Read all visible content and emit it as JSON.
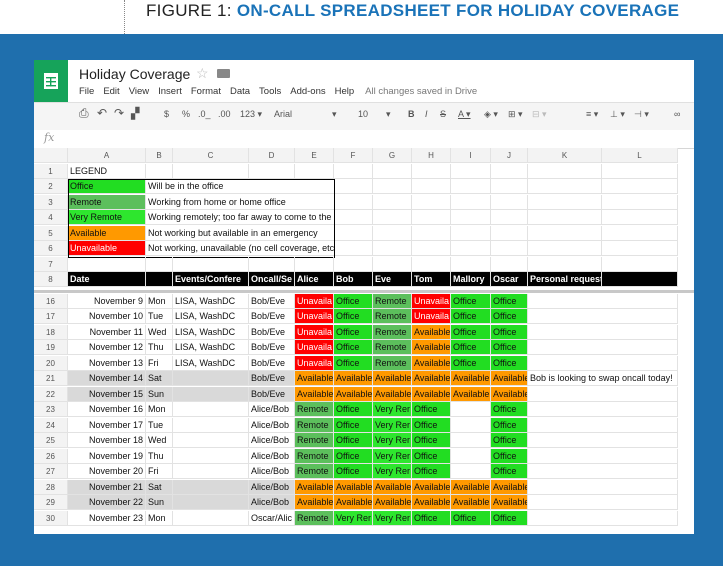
{
  "figure": {
    "title": "FIGURE 1:",
    "subtitle": "ON-CALL SPREADSHEET FOR HOLIDAY COVERAGE"
  },
  "app": {
    "doc_title": "Holiday Coverage",
    "star_icon": "star-icon",
    "folder_icon": "folder-icon"
  },
  "menu": {
    "items": [
      "File",
      "Edit",
      "View",
      "Insert",
      "Format",
      "Data",
      "Tools",
      "Add-ons",
      "Help"
    ],
    "saved": "All changes saved in Drive"
  },
  "toolbar": {
    "currency": "$",
    "percent": "%",
    "dec_less": ".0_",
    "dec_more": ".00",
    "format": "123",
    "font": "Arial",
    "size": "10",
    "bold": "B",
    "italic": "I",
    "strike": "S",
    "textcolor": "A"
  },
  "formula": {
    "label": "fx"
  },
  "columns": [
    "A",
    "B",
    "C",
    "D",
    "E",
    "F",
    "G",
    "H",
    "I",
    "J",
    "K",
    "L"
  ],
  "legend_title": "LEGEND",
  "legend": [
    {
      "row": "2",
      "label": "Office",
      "desc": "Will be in the office",
      "color": "#22dd22"
    },
    {
      "row": "3",
      "label": "Remote",
      "desc": "Working from home or home office",
      "color": "#5cbf5c"
    },
    {
      "row": "4",
      "label": "Very Remote",
      "desc": "Working remotely; too far away to come to the datacenter if needed",
      "color": "#2ee62e"
    },
    {
      "row": "5",
      "label": "Available",
      "desc": "Not working but available in an emergency",
      "color": "#ff9900"
    },
    {
      "row": "6",
      "label": "Unavailable",
      "desc": "Not working, unavailable (no cell coverage, etc.)",
      "color": "#ff0000"
    }
  ],
  "header_row": {
    "num": "8",
    "cells": [
      "Date",
      "",
      "Events/Confere",
      "Oncall/Se",
      "Alice",
      "Bob",
      "Eve",
      "Tom",
      "Mallory",
      "Oscar",
      "Personal requests, notes, etc.",
      ""
    ]
  },
  "rows": [
    {
      "num": "16",
      "date": "November 9",
      "day": "Mon",
      "events": "LISA, WashDC",
      "oncall": "Bob/Eve",
      "s": [
        "Unavaila",
        "Office",
        "Remote",
        "Unavaila",
        "Office",
        "Office"
      ],
      "notes": "",
      "weekend": false
    },
    {
      "num": "17",
      "date": "November 10",
      "day": "Tue",
      "events": "LISA, WashDC",
      "oncall": "Bob/Eve",
      "s": [
        "Unavaila",
        "Office",
        "Remote",
        "Unavaila",
        "Office",
        "Office"
      ],
      "notes": "",
      "weekend": false
    },
    {
      "num": "18",
      "date": "November 11",
      "day": "Wed",
      "events": "LISA, WashDC",
      "oncall": "Bob/Eve",
      "s": [
        "Unavaila",
        "Office",
        "Remote",
        "Available",
        "Office",
        "Office"
      ],
      "notes": "",
      "weekend": false
    },
    {
      "num": "19",
      "date": "November 12",
      "day": "Thu",
      "events": "LISA, WashDC",
      "oncall": "Bob/Eve",
      "s": [
        "Unavaila",
        "Office",
        "Remote",
        "Available",
        "Office",
        "Office"
      ],
      "notes": "",
      "weekend": false
    },
    {
      "num": "20",
      "date": "November 13",
      "day": "Fri",
      "events": "LISA, WashDC",
      "oncall": "Bob/Eve",
      "s": [
        "Unavaila",
        "Office",
        "Remote",
        "Available",
        "Office",
        "Office"
      ],
      "notes": "",
      "weekend": false
    },
    {
      "num": "21",
      "date": "November 14",
      "day": "Sat",
      "events": "",
      "oncall": "Bob/Eve",
      "s": [
        "Available",
        "Available",
        "Available",
        "Available",
        "Available",
        "Available"
      ],
      "notes": "Bob is looking to swap oncall today!",
      "weekend": true
    },
    {
      "num": "22",
      "date": "November 15",
      "day": "Sun",
      "events": "",
      "oncall": "Bob/Eve",
      "s": [
        "Available",
        "Available",
        "Available",
        "Available",
        "Available",
        "Available"
      ],
      "notes": "",
      "weekend": true
    },
    {
      "num": "23",
      "date": "November 16",
      "day": "Mon",
      "events": "",
      "oncall": "Alice/Bob",
      "s": [
        "Remote",
        "Office",
        "Very Rer",
        "Office",
        "",
        "Office"
      ],
      "notes": "",
      "weekend": false
    },
    {
      "num": "24",
      "date": "November 17",
      "day": "Tue",
      "events": "",
      "oncall": "Alice/Bob",
      "s": [
        "Remote",
        "Office",
        "Very Rer",
        "Office",
        "",
        "Office"
      ],
      "notes": "",
      "weekend": false
    },
    {
      "num": "25",
      "date": "November 18",
      "day": "Wed",
      "events": "",
      "oncall": "Alice/Bob",
      "s": [
        "Remote",
        "Office",
        "Very Rer",
        "Office",
        "",
        "Office"
      ],
      "notes": "",
      "weekend": false
    },
    {
      "num": "26",
      "date": "November 19",
      "day": "Thu",
      "events": "",
      "oncall": "Alice/Bob",
      "s": [
        "Remote",
        "Office",
        "Very Rer",
        "Office",
        "",
        "Office"
      ],
      "notes": "",
      "weekend": false
    },
    {
      "num": "27",
      "date": "November 20",
      "day": "Fri",
      "events": "",
      "oncall": "Alice/Bob",
      "s": [
        "Remote",
        "Office",
        "Very Rer",
        "Office",
        "",
        "Office"
      ],
      "notes": "",
      "weekend": false
    },
    {
      "num": "28",
      "date": "November 21",
      "day": "Sat",
      "events": "",
      "oncall": "Alice/Bob",
      "s": [
        "Available",
        "Available",
        "Available",
        "Available",
        "Available",
        "Available"
      ],
      "notes": "",
      "weekend": true
    },
    {
      "num": "29",
      "date": "November 22",
      "day": "Sun",
      "events": "",
      "oncall": "Alice/Bob",
      "s": [
        "Available",
        "Available",
        "Available",
        "Available",
        "Available",
        "Available"
      ],
      "notes": "",
      "weekend": true
    },
    {
      "num": "30",
      "date": "November 23",
      "day": "Mon",
      "events": "",
      "oncall": "Oscar/Alic",
      "s": [
        "Remote",
        "Very Rer",
        "Very Rer",
        "Office",
        "Office",
        "Office"
      ],
      "notes": "",
      "weekend": false
    }
  ],
  "status_colors": {
    "Office": "#22dd22",
    "Remote": "#5cbf5c",
    "Very Rer": "#2ee62e",
    "Available": "#ff9900",
    "Unavaila": "#ff0000"
  }
}
